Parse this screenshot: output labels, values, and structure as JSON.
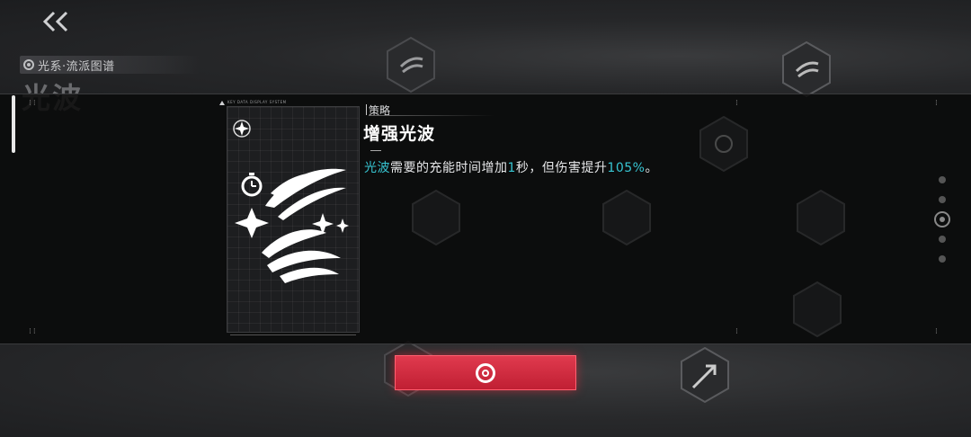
{
  "header": {
    "back_label": "<<",
    "school_title": "光系·流派图谱",
    "school_name": "光波"
  },
  "card": {
    "header_text": "KEY DATA DISPLAY SYSTEM",
    "icon": "light-wave-skill-icon"
  },
  "detail": {
    "tag": "策略",
    "title": "增强光波",
    "desc_parts": {
      "skill": "光波",
      "p1": "需要的充能时间增加",
      "n1": "1",
      "p2": "秒，但伤害提升",
      "n2": "105%",
      "p3": "。"
    }
  },
  "colors": {
    "highlight": "#37c6d3",
    "confirm": "#d42a3e"
  },
  "confirm_button": {
    "icon": "confirm-ring-icon"
  }
}
